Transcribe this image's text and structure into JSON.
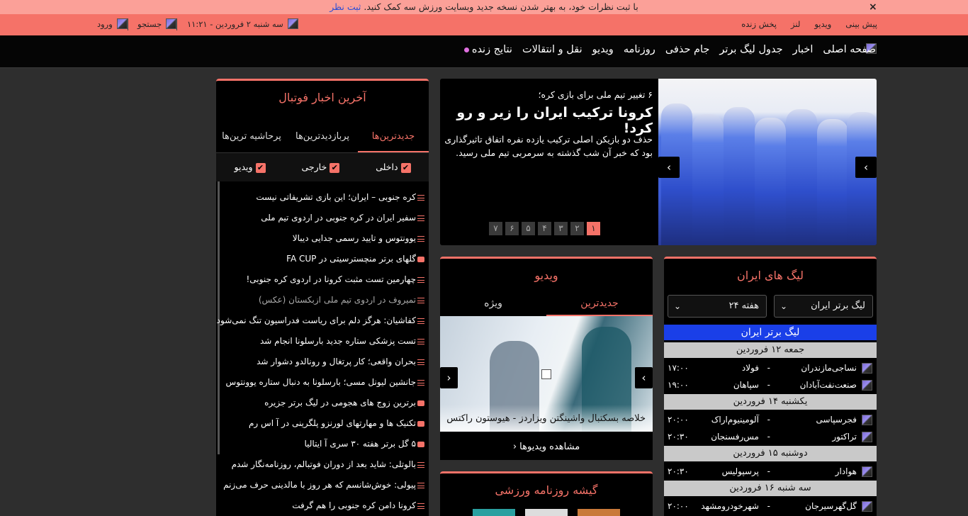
{
  "notice": {
    "text": "با ثبت نظرات خود، به بهتر شدن نسخه جدید وبسایت ورزش سه کمک کنید.",
    "link": "ثبت نظر",
    "close": "×"
  },
  "topbar": {
    "links": [
      "پیش بینی",
      "ویدیو",
      "لنز",
      "پخش زنده"
    ],
    "date": "سه شنبه ۲ فروردین - ۱۱:۲۱",
    "search": "جستجو",
    "login": "ورود"
  },
  "nav": {
    "items": [
      "صفحه اصلی",
      "اخبار",
      "جدول لیگ برتر",
      "جام حذفی",
      "روزنامه",
      "ویدیو",
      "نقل و انتقالات",
      "نتایج زنده"
    ]
  },
  "hero": {
    "kicker": "۶ تغییر تیم ملی برای بازی کره؛",
    "title": "کرونا ترکیب ایران را زیر و رو کرد!",
    "lead": "حذف دو بازیکن اصلی ترکیب یازده نفره اتفاق تاثیرگذاری بود که خبر آن شب گذشته به سرمربی تیم ملی رسید.",
    "pages": [
      "۱",
      "۲",
      "۳",
      "۴",
      "۵",
      "۶",
      "۷"
    ],
    "active_page": 0
  },
  "news": {
    "title": "آخرین اخبار فوتبال",
    "tabs": [
      "جدیدترین‌ها",
      "پربازدیدترین‌ها",
      "پرحاشیه ترین‌ها"
    ],
    "filters": [
      "داخلی",
      "خارجی",
      "ویدیو"
    ],
    "items": [
      {
        "text": "کره جنوبی – ایران؛ این بازی تشریفاتی نیست",
        "type": "txt"
      },
      {
        "text": "سفیر ایران در کره جنوبی در اردوی تیم ملی",
        "type": "txt"
      },
      {
        "text": "یوونتوس و تایید رسمی جدایی دیبالا",
        "type": "txt"
      },
      {
        "text": "گلهای برتر منچسترسیتی در FA CUP",
        "type": "vid"
      },
      {
        "text": "چهارمین تست مثبت کرونا در اردوی کره جنوبی!",
        "type": "txt"
      },
      {
        "text": "تمیروف در اردوی تیم ملی ازبکستان (عکس)",
        "type": "txt"
      },
      {
        "text": "کفاشیان: هرگز دلم برای ریاست فدراسیون تنگ نمی‌شود",
        "type": "txt"
      },
      {
        "text": "تست پزشکی ستاره جدید بارسلونا انجام شد",
        "type": "txt"
      },
      {
        "text": "بحران واقعی؛ کار پرتغال و رونالدو دشوار شد",
        "type": "txt"
      },
      {
        "text": "جانشین لیونل مسی؛ بارسلونا به دنبال ستاره یوونتوس",
        "type": "txt"
      },
      {
        "text": "برترین زوج های هجومی در لیگ برتر جزیره",
        "type": "vid"
      },
      {
        "text": "تکنیک ها و مهارتهای لورنزو پلگرینی در آ اس رم",
        "type": "vid"
      },
      {
        "text": "۵ گل برتر هفته ۳۰ سری آ ایتالیا",
        "type": "vid"
      },
      {
        "text": "بالوتلی: شاید بعد از دوران فوتبالم، روزنامه‌نگار شدم",
        "type": "txt"
      },
      {
        "text": "پیولی: خوش‌شانسم که هر روز با مالدینی حرف می‌زنم",
        "type": "txt"
      },
      {
        "text": "کرونا دامن کره جنوبی را هم گرفت",
        "type": "txt"
      }
    ]
  },
  "video": {
    "title": "ویدیو",
    "tabs": [
      "جدیدترین",
      "ویژه"
    ],
    "caption": "خلاصه بسکتبال واشینگتن ویزاردز - هیوستون راکتس",
    "more": "مشاهده ویدیوها"
  },
  "newspaper": {
    "title": "گیشه روزنامه ورزشی"
  },
  "league": {
    "title": "لیگ های ایران",
    "select_league": "لیگ برتر ایران",
    "select_week": "هفته ۲۴",
    "bar": "لیگ برتر ایران",
    "days": [
      {
        "label": "جمعه ۱۲ فروردین",
        "matches": [
          {
            "home": "نساجی‌مازندران",
            "away": "فولاد",
            "time": "۱۷:۰۰"
          },
          {
            "home": "صنعت‌نفت‌آبادان",
            "away": "سپاهان",
            "time": "۱۹:۰۰"
          }
        ]
      },
      {
        "label": "یکشنبه ۱۴ فروردین",
        "matches": [
          {
            "home": "فجرسپاسی",
            "away": "آلومینیوم‌اراک",
            "time": "۲۰:۰۰"
          },
          {
            "home": "تراکتور",
            "away": "مس‌رفسنجان",
            "time": "۲۰:۳۰"
          }
        ]
      },
      {
        "label": "دوشنبه ۱۵ فروردین",
        "matches": [
          {
            "home": "هوادار",
            "away": "پرسپولیس",
            "time": "۲۰:۳۰"
          }
        ]
      },
      {
        "label": "سه شنبه ۱۶ فروردین",
        "matches": [
          {
            "home": "گل‌گهرسیرجان",
            "away": "شهرخودرومشهد",
            "time": "۲۰:۰۰"
          }
        ]
      }
    ]
  },
  "colors": {
    "accent": "#f57268",
    "league_bar": "#1a3fe8",
    "day_bg": "#c9c9c9"
  }
}
